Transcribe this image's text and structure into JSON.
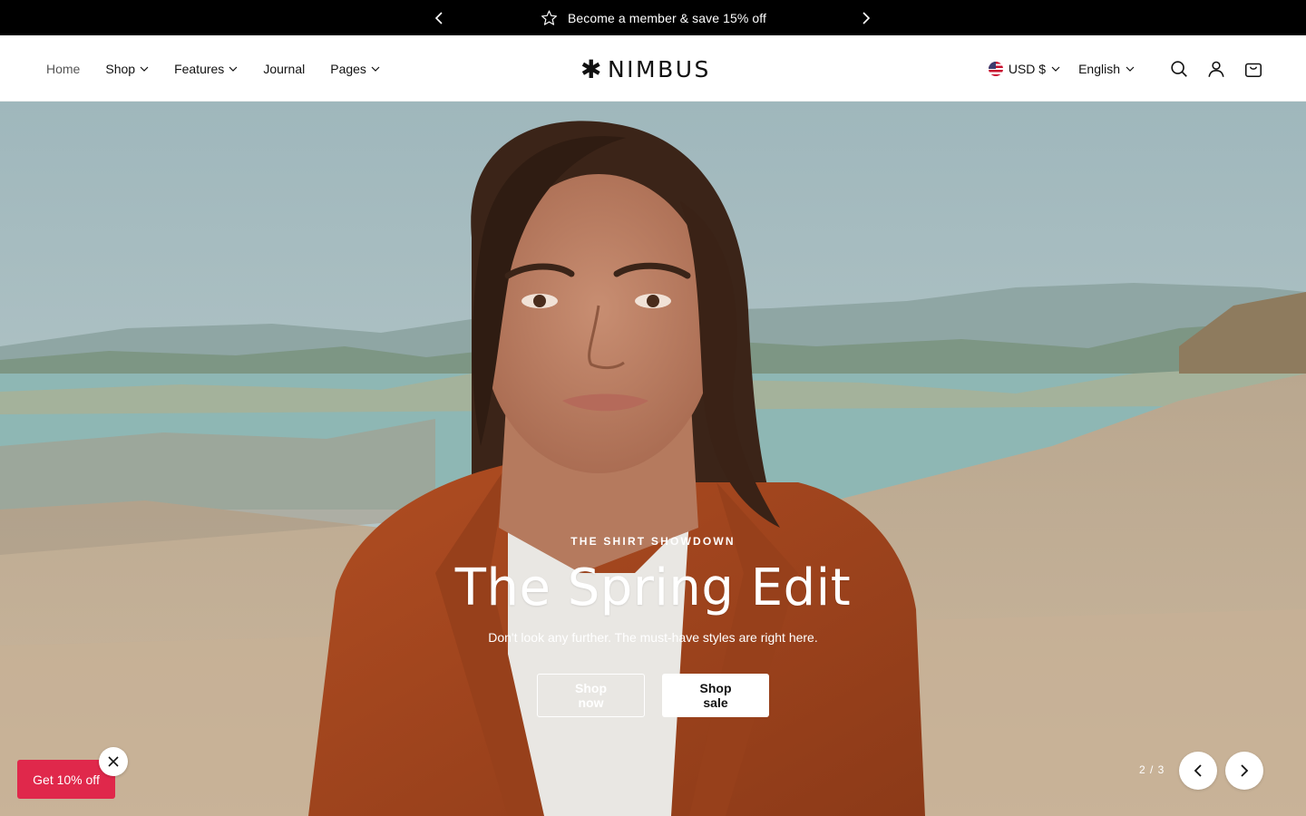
{
  "announcement": {
    "message": "Become a member & save 15% off",
    "prev_icon": "chevron-left-icon",
    "next_icon": "chevron-right-icon",
    "star_icon": "star-icon"
  },
  "header": {
    "logo_text": "NIMBUS",
    "logo_mark": "✱",
    "nav": [
      {
        "label": "Home"
      },
      {
        "label": "Shop"
      },
      {
        "label": "Features"
      },
      {
        "label": "Journal"
      },
      {
        "label": "Pages"
      }
    ],
    "currency": "USD $",
    "language": "English"
  },
  "hero": {
    "eyebrow": "THE SHIRT SHOWDOWN",
    "title": "The Spring Edit",
    "subtitle": "Don't look any further. The must-have styles are right here.",
    "primary_button": "Shop now",
    "secondary_button": "Shop sale",
    "pager": "2 / 3"
  },
  "promo": {
    "label": "Get 10% off"
  },
  "colors": {
    "announce_bg": "#000000",
    "promo_bg": "#e0284b",
    "jacket": "#a4461f",
    "sky": "#a9bfc4",
    "lake": "#8eb7b4",
    "sand": "#c9b49a"
  }
}
